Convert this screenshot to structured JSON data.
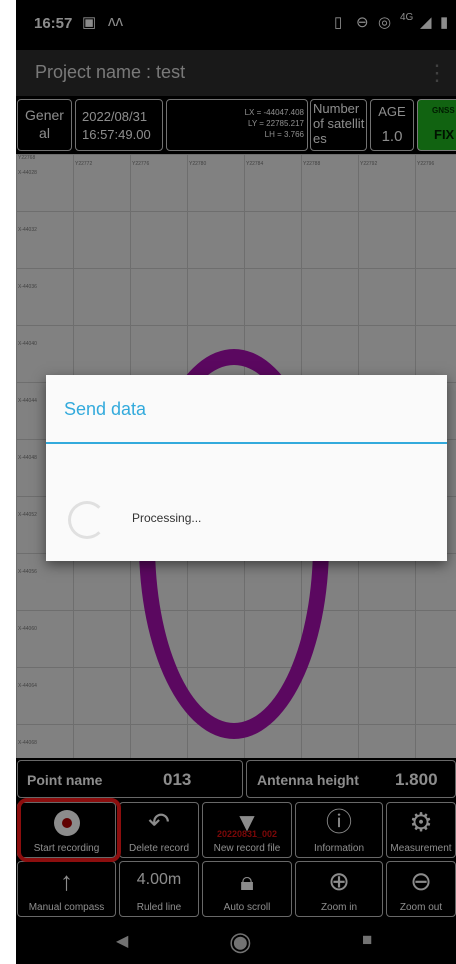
{
  "status": {
    "time": "16:57",
    "network": "4G"
  },
  "titlebar": {
    "title": "Project name : test"
  },
  "info": {
    "mode": "General",
    "date": "2022/08/31",
    "clock": "16:57:49.00",
    "lx": "LX = -44047.408",
    "ly": "LY = 22785.217",
    "lh": "LH = 3.766",
    "sat_label": "Number of satellites",
    "age_label": "AGE",
    "age_value": "1.0",
    "gnss_label": "GNSS",
    "gnss_value": "FIX",
    "gnss_color": "#1fb51f"
  },
  "map": {
    "x_labels": [
      "Y22768",
      "Y22772",
      "Y22776",
      "Y22780",
      "Y22784",
      "Y22788",
      "Y22792",
      "Y22796"
    ],
    "y_labels": [
      "X-44028",
      "X-44032",
      "X-44036",
      "X-44040",
      "X-44044",
      "X-44048",
      "X-44052",
      "X-44056",
      "X-44060",
      "X-44064",
      "X-44068"
    ],
    "ring_color": "#a70fb0"
  },
  "dialog": {
    "title": "Send data",
    "message": "Processing..."
  },
  "point": {
    "name_label": "Point name",
    "name_value": "013",
    "antenna_label": "Antenna height",
    "antenna_value": "1.800"
  },
  "buttons": {
    "start_recording": "Start recording",
    "delete_record": "Delete record",
    "new_record_file": "New record file",
    "record_file_name": "20220831_002",
    "information": "Information",
    "measurement": "Measurement",
    "manual_compass": "Manual compass",
    "ruled_value": "4.00m",
    "ruled_line": "Ruled line",
    "auto_scroll": "Auto scroll",
    "zoom_in": "Zoom in",
    "zoom_out": "Zoom out"
  }
}
